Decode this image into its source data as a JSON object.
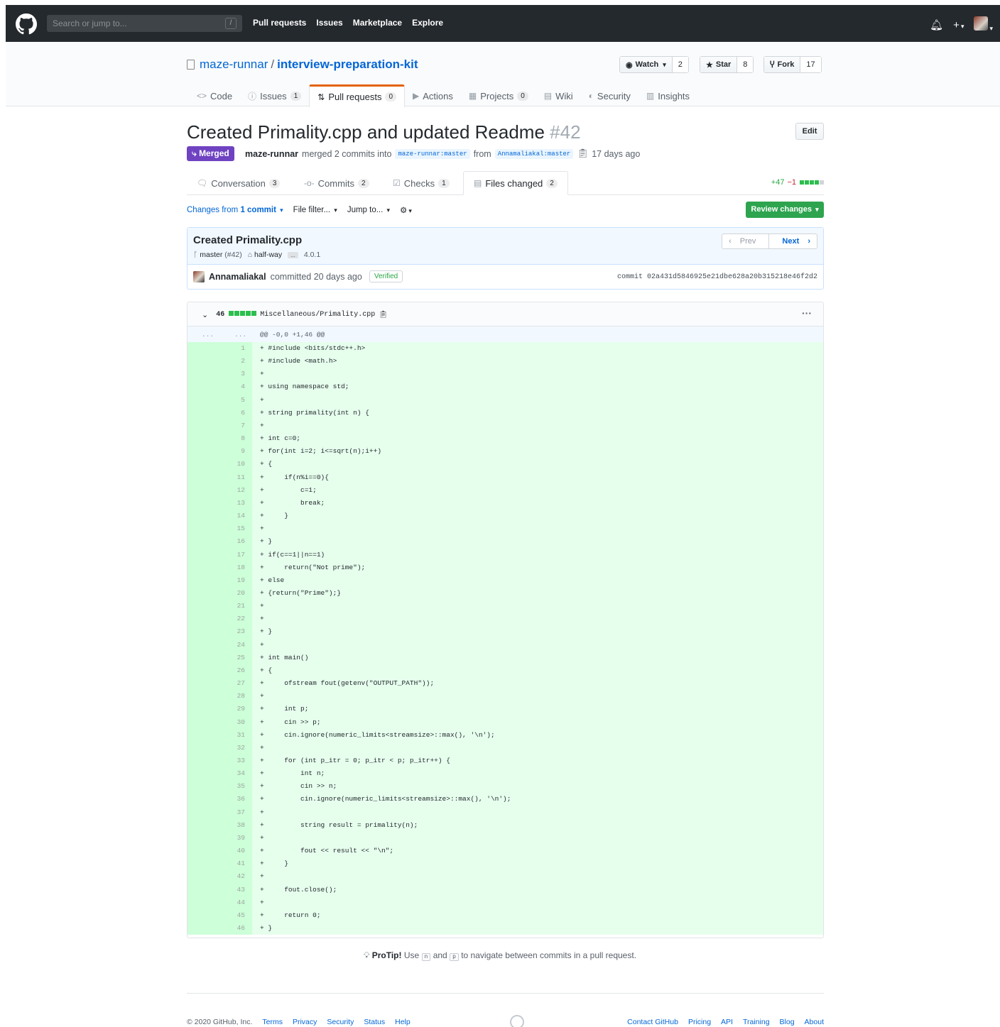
{
  "header": {
    "search_placeholder": "Search or jump to...",
    "slash": "/",
    "nav": [
      "Pull requests",
      "Issues",
      "Marketplace",
      "Explore"
    ],
    "icons": [
      "github-logo",
      "bell-icon",
      "plus-icon",
      "avatar"
    ]
  },
  "repo": {
    "owner": "maze-runnar",
    "sep": "/",
    "name": "interview-preparation-kit",
    "watch": {
      "label": "Watch",
      "count": "2"
    },
    "star": {
      "label": "Star",
      "count": "8"
    },
    "fork": {
      "label": "Fork",
      "count": "17"
    },
    "tabs": [
      {
        "icon": "<>",
        "label": "Code",
        "count": ""
      },
      {
        "icon": "ⓘ",
        "label": "Issues",
        "count": "1"
      },
      {
        "icon": "⇅",
        "label": "Pull requests",
        "count": "0"
      },
      {
        "icon": "▶",
        "label": "Actions",
        "count": ""
      },
      {
        "icon": "▦",
        "label": "Projects",
        "count": "0"
      },
      {
        "icon": "▤",
        "label": "Wiki",
        "count": ""
      },
      {
        "icon": "◐",
        "label": "Security",
        "count": ""
      },
      {
        "icon": "▥",
        "label": "Insights",
        "count": ""
      }
    ]
  },
  "pr": {
    "title": "Created Primality.cpp and updated Readme",
    "number": "#42",
    "edit": "Edit",
    "state": "Merged",
    "author": "maze-runnar",
    "merged_text": "merged 2 commits into",
    "base": "maze-runnar:master",
    "from": "from",
    "head": "Annamaliakal:master",
    "time": "17 days ago",
    "tabs": [
      {
        "label": "Conversation",
        "count": "3"
      },
      {
        "label": "Commits",
        "count": "2"
      },
      {
        "label": "Checks",
        "count": "1"
      },
      {
        "label": "Files changed",
        "count": "2"
      }
    ],
    "additions": "+47",
    "deletions": "−1"
  },
  "toolbar": {
    "changes_from": "Changes from",
    "commit_sel": "1 commit",
    "file_filter": "File filter...",
    "jump_to": "Jump to...",
    "review": "Review changes"
  },
  "commit": {
    "title": "Created Primality.cpp",
    "branch": "master",
    "branch_pr": "(#42)",
    "tag1": "half-way",
    "ellipsis": "...",
    "tag2": "4.0.1",
    "prev": "Prev",
    "next": "Next",
    "author": "Annamaliakal",
    "committed": "committed 20 days ago",
    "verified": "Verified",
    "sha": "commit 02a431d5846925e21dbe628a20b315218e46f2d2"
  },
  "file": {
    "changes": "46",
    "path": "Miscellaneous/Primality.cpp",
    "more": "···",
    "hunk_dots1": "...",
    "hunk_dots2": "...",
    "hunk": "@@ -0,0 +1,46 @@",
    "lines": [
      "+ #include <bits/stdc++.h>",
      "+ #include <math.h>",
      "+",
      "+ using namespace std;",
      "+",
      "+ string primality(int n) {",
      "+",
      "+ int c=0;",
      "+ for(int i=2; i<=sqrt(n);i++)",
      "+ {",
      "+     if(n%i==0){",
      "+         c=1;",
      "+         break;",
      "+     }",
      "+",
      "+ }",
      "+ if(c==1||n==1)",
      "+     return(\"Not prime\");",
      "+ else",
      "+ {return(\"Prime\");}",
      "+",
      "+",
      "+ }",
      "+",
      "+ int main()",
      "+ {",
      "+     ofstream fout(getenv(\"OUTPUT_PATH\"));",
      "+",
      "+     int p;",
      "+     cin >> p;",
      "+     cin.ignore(numeric_limits<streamsize>::max(), '\\n');",
      "+",
      "+     for (int p_itr = 0; p_itr < p; p_itr++) {",
      "+         int n;",
      "+         cin >> n;",
      "+         cin.ignore(numeric_limits<streamsize>::max(), '\\n');",
      "+",
      "+         string result = primality(n);",
      "+",
      "+         fout << result << \"\\n\";",
      "+     }",
      "+",
      "+     fout.close();",
      "+",
      "+     return 0;",
      "+ }"
    ]
  },
  "protip": {
    "label": "ProTip!",
    "pre": "Use",
    "k1": "n",
    "mid": "and",
    "k2": "p",
    "post": "to navigate between commits in a pull request."
  },
  "footer": {
    "copyright": "© 2020 GitHub, Inc.",
    "left": [
      "Terms",
      "Privacy",
      "Security",
      "Status",
      "Help"
    ],
    "right": [
      "Contact GitHub",
      "Pricing",
      "API",
      "Training",
      "Blog",
      "About"
    ]
  }
}
